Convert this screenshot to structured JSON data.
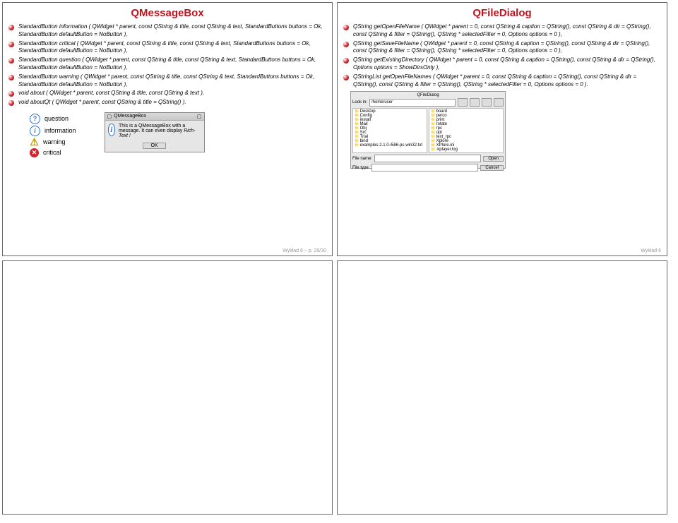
{
  "slides": {
    "qmb": {
      "title": "QMessageBox",
      "bullets": [
        "StandardButton information ( QWidget * parent, const QString & title, const QString & text, StandardButtons buttons = Ok, StandardButton defaultButton = NoButton ),",
        "StandardButton critical ( QWidget * parent, const QString & title, const QString & text, StandardButtons buttons = Ok, StandardButton defaultButton = NoButton ),",
        "StandardButton question ( QWidget * parent, const QString & title, const QString & text, StandardButtons buttons = Ok, StandardButton defaultButton = NoButton ),",
        "StandardButton warning ( QWidget * parent, const QString & title, const QString & text, StandardButtons buttons = Ok, StandardButton defaultButton = NoButton ),",
        "void about ( QWidget * parent, const QString & title, const QString & text ),",
        "void aboutQt ( QWidget * parent, const QString & title = QString() )."
      ],
      "icon_labels": [
        "question",
        "information",
        "warning",
        "critical"
      ],
      "demo": {
        "title": "QMessageBox",
        "body1": "This is a QMessageBox with a message. It can even display",
        "body2": "Rich-Text !",
        "ok": "OK"
      }
    },
    "qfd": {
      "title": "QFileDialog",
      "bullets": [
        "QString getOpenFileName ( QWidget * parent = 0, const QString & caption = QString(), const QString & dir = QString(), const QString & filter = QString(), QString * selectedFilter = 0, Options options = 0 ),",
        "QString getSaveFileName ( QWidget * parent = 0, const QString & caption = QString(), const QString & dir = QString(), const QString & filter = QString(), QString * selectedFilter = 0, Options options = 0 ),",
        "QString getExistingDirectory ( QWidget * parent = 0, const QString & caption = QString(), const QString & dir = QString(), Options options = ShowDirsOnly ),",
        "QStringList getOpenFileNames ( QWidget * parent = 0, const QString & caption = QString(), const QString & dir = QString(), const QString & filter = QString(), QString * selectedFilter = 0, Options options = 0 )."
      ],
      "fd": {
        "title": "QFileDialog",
        "look": "Look in:",
        "path": "/home/user",
        "col1": [
          "Desktop",
          "Config",
          "install",
          "Mail",
          "Obj",
          "Src",
          "Trial",
          "bind",
          "examples-2.1.0-i586-pc-win32.txt"
        ],
        "col2": [
          "board",
          "perco",
          "print",
          "rotate",
          "rpc",
          "opt",
          "text_rpc",
          "Xplore",
          "XPlore.ini",
          ".kplayer.log"
        ],
        "fname": "File name:",
        "ftype": "File type:",
        "open": "Open",
        "cancel": "Cancel"
      }
    },
    "footer_left": "Wykład 6 – p. 29/30",
    "footer_right": "Wykład 6"
  }
}
